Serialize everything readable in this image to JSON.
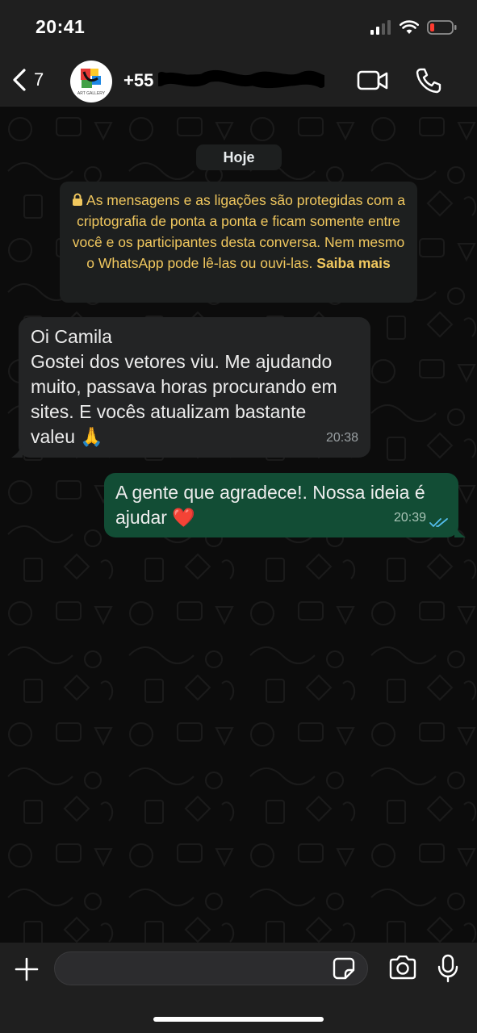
{
  "status_bar": {
    "time": "20:41",
    "icons": [
      "signal-icon",
      "wifi-icon",
      "battery-low-icon"
    ]
  },
  "header": {
    "unread_count": "7",
    "contact_name": "+55",
    "avatar_caption": "ART GALLERY",
    "icons": [
      "chevron-left-icon",
      "video-camera-icon",
      "phone-icon"
    ]
  },
  "chat": {
    "date_chip": "Hoje",
    "encryption_notice": {
      "text": "As mensagens e as ligações são protegidas com a criptografia de ponta a ponta e ficam somente entre você e os participantes desta conversa. Nem mesmo o WhatsApp pode lê-las ou ouvi-las.",
      "link": "Saiba mais"
    },
    "messages": [
      {
        "direction": "incoming",
        "lines": [
          "Oi Camila",
          "Gostei dos vetores viu. Me ajudando",
          "muito, passava horas procurando em",
          "sites. E vocês atualizam bastante",
          "valeu 🙏"
        ],
        "time": "20:38"
      },
      {
        "direction": "outgoing",
        "lines": [
          "A gente que agradece!. Nossa ideia é",
          "ajudar ❤️"
        ],
        "time": "20:39",
        "status": "read"
      }
    ]
  },
  "input_bar": {
    "placeholder": "",
    "icons": [
      "plus-icon",
      "sticker-icon",
      "camera-icon",
      "microphone-icon"
    ]
  },
  "colors": {
    "header_bg": "#1f1f1f",
    "incoming_bubble": "#232425",
    "outgoing_bubble": "#124d35",
    "notice_text": "#f0c75e",
    "read_receipt": "#53bdeb"
  }
}
